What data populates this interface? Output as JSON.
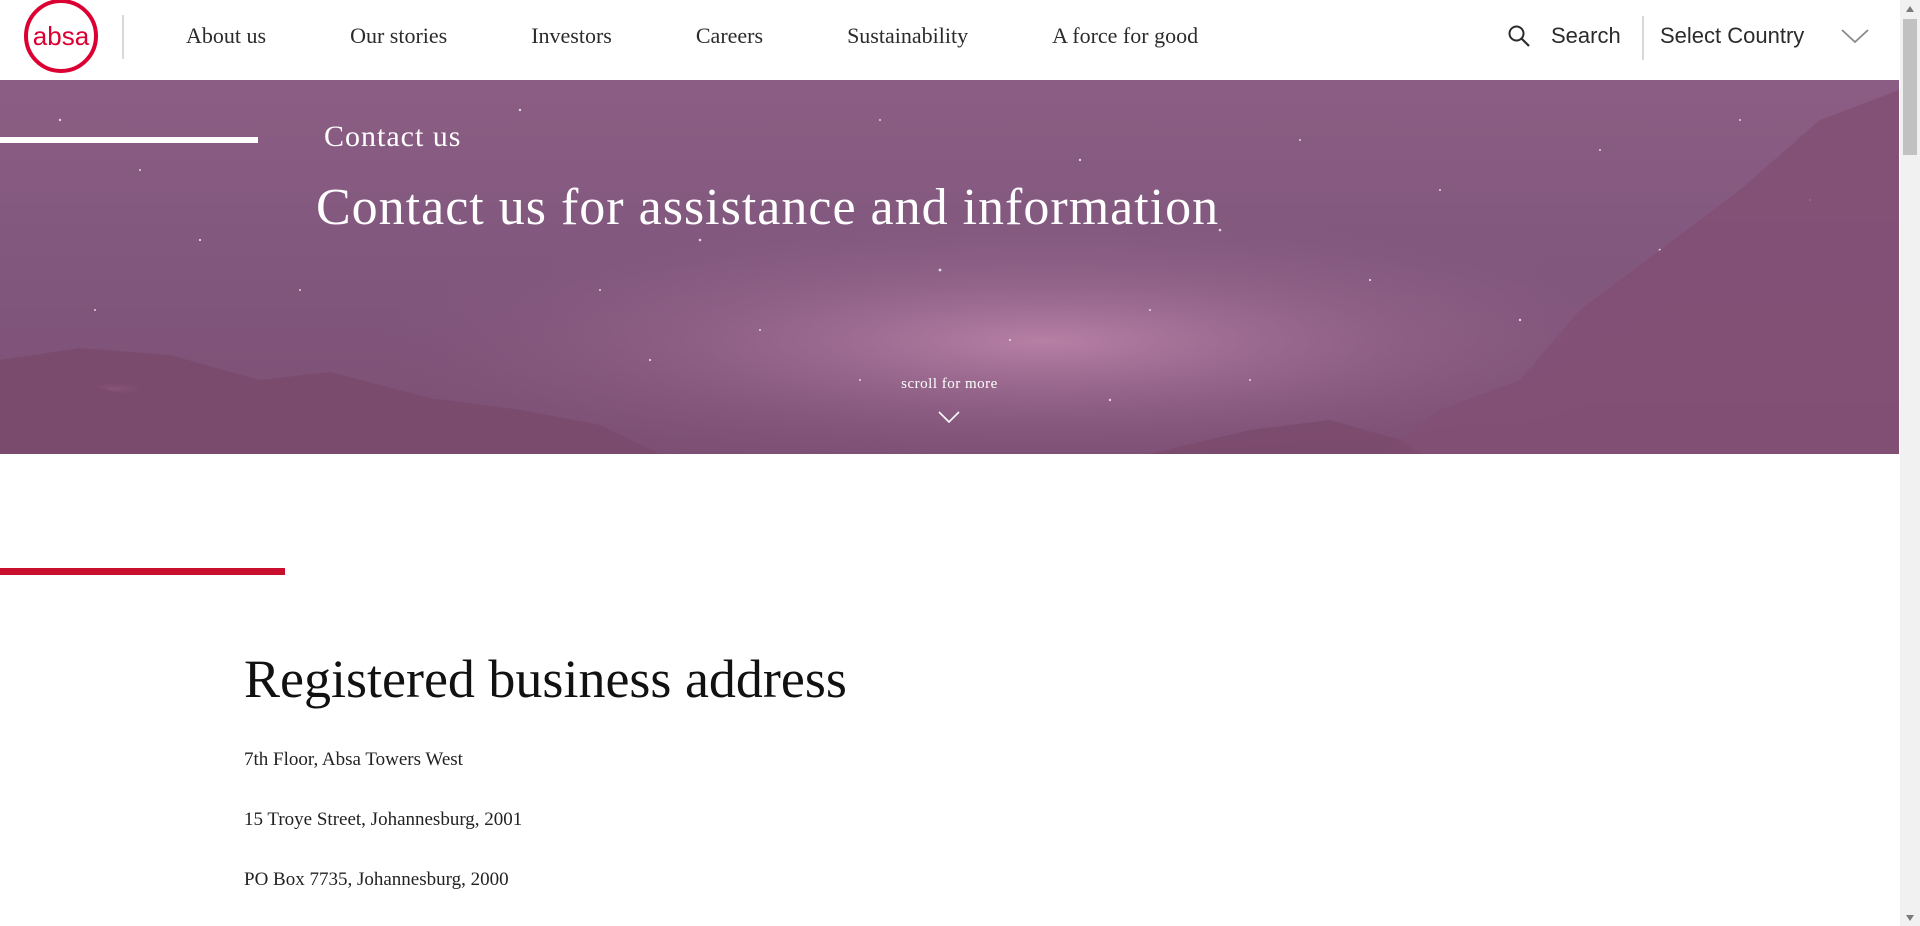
{
  "header": {
    "logo_text": "absa",
    "brand_color": "#dc0032",
    "nav": [
      {
        "label": "About us"
      },
      {
        "label": "Our stories"
      },
      {
        "label": "Investors"
      },
      {
        "label": "Careers"
      },
      {
        "label": "Sustainability"
      },
      {
        "label": "A force for good"
      }
    ],
    "search_label": "Search",
    "search_icon": "search-icon",
    "country_select": {
      "selected": "Select Country",
      "icon": "chevron-down-icon"
    }
  },
  "hero": {
    "eyebrow": "Contact us",
    "title": "Contact us for assistance and information",
    "scroll_text": "scroll for more",
    "background": "purple starry night sky with mountains"
  },
  "content": {
    "accent_color": "#c8102e",
    "section_title": "Registered business address",
    "address": [
      "7th Floor, Absa Towers West",
      "15 Troye Street, Johannesburg, 2001",
      "PO Box 7735, Johannesburg, 2000"
    ]
  }
}
